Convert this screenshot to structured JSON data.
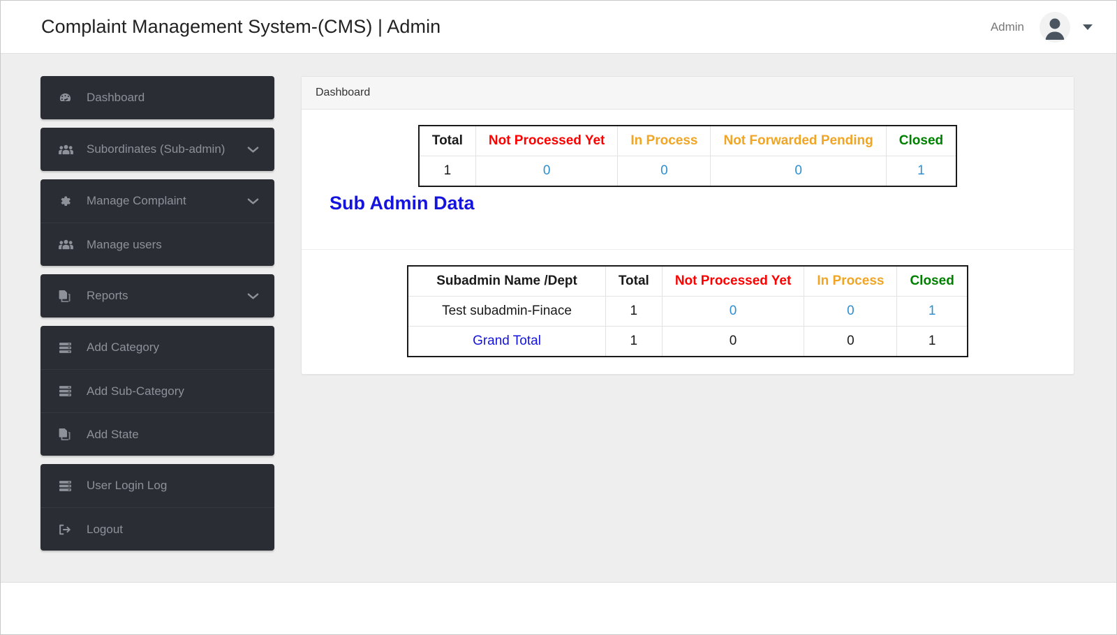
{
  "navbar": {
    "brand_title": "Complaint Management System-(CMS) | Admin",
    "user_name": "Admin",
    "avatar_icon": "user-avatar-icon",
    "caret_icon": "caret-down-icon"
  },
  "sidebar": {
    "groups": [
      {
        "items": [
          {
            "label": "Dashboard",
            "icon": "tachometer-icon",
            "has_caret": false
          }
        ]
      },
      {
        "items": [
          {
            "label": "Subordinates (Sub-admin)",
            "icon": "users-icon",
            "has_caret": true
          }
        ]
      },
      {
        "items": [
          {
            "label": "Manage Complaint",
            "icon": "gear-icon",
            "has_caret": true
          },
          {
            "label": "Manage users",
            "icon": "users-icon",
            "has_caret": false
          }
        ]
      },
      {
        "items": [
          {
            "label": "Reports",
            "icon": "copy-files-icon",
            "has_caret": true
          }
        ]
      },
      {
        "items": [
          {
            "label": "Add Category",
            "icon": "server-list-icon",
            "has_caret": false
          },
          {
            "label": "Add Sub-Category",
            "icon": "server-list-icon",
            "has_caret": false
          },
          {
            "label": "Add State",
            "icon": "copy-files-icon",
            "has_caret": false
          }
        ]
      },
      {
        "items": [
          {
            "label": "User Login Log",
            "icon": "server-list-icon",
            "has_caret": false
          },
          {
            "label": "Logout",
            "icon": "sign-out-icon",
            "has_caret": false
          }
        ]
      }
    ]
  },
  "main": {
    "panel_heading": "Dashboard",
    "section_title": "Sub Admin Data",
    "summary_table": {
      "headers": [
        {
          "text": "Total",
          "color_class": "c-dark"
        },
        {
          "text": "Not Processed Yet",
          "color_class": "c-red"
        },
        {
          "text": "In Process",
          "color_class": "c-orange"
        },
        {
          "text": "Not Forwarded Pending",
          "color_class": "c-orange"
        },
        {
          "text": "Closed",
          "color_class": "c-green"
        }
      ],
      "rows": [
        [
          {
            "text": "1",
            "color_class": "c-dark"
          },
          {
            "text": "0",
            "color_class": "c-link"
          },
          {
            "text": "0",
            "color_class": "c-link"
          },
          {
            "text": "0",
            "color_class": "c-link"
          },
          {
            "text": "1",
            "color_class": "c-link"
          }
        ]
      ]
    },
    "subadmin_table": {
      "headers": [
        {
          "text": "Subadmin Name /Dept",
          "color_class": "c-dark"
        },
        {
          "text": "Total",
          "color_class": "c-dark"
        },
        {
          "text": "Not Processed Yet",
          "color_class": "c-red"
        },
        {
          "text": "In Process",
          "color_class": "c-orange"
        },
        {
          "text": "Closed",
          "color_class": "c-green"
        }
      ],
      "rows": [
        [
          {
            "text": "Test subadmin-Finace",
            "color_class": "c-dark"
          },
          {
            "text": "1",
            "color_class": "c-dark"
          },
          {
            "text": "0",
            "color_class": "c-link"
          },
          {
            "text": "0",
            "color_class": "c-link"
          },
          {
            "text": "1",
            "color_class": "c-link"
          }
        ],
        [
          {
            "text": "Grand Total",
            "color_class": "c-blue"
          },
          {
            "text": "1",
            "color_class": "c-dark"
          },
          {
            "text": "0",
            "color_class": "c-dark"
          },
          {
            "text": "0",
            "color_class": "c-dark"
          },
          {
            "text": "1",
            "color_class": "c-dark"
          }
        ]
      ]
    }
  },
  "colors": {
    "sidebar_bg": "#2a2d33",
    "sidebar_text": "#8d9199",
    "body_bg": "#eeeeee",
    "accent_red": "#ff0000",
    "accent_orange": "#f0a525",
    "accent_green": "#008000",
    "accent_blue": "#1414dd",
    "link_blue": "#2e8fd0"
  }
}
